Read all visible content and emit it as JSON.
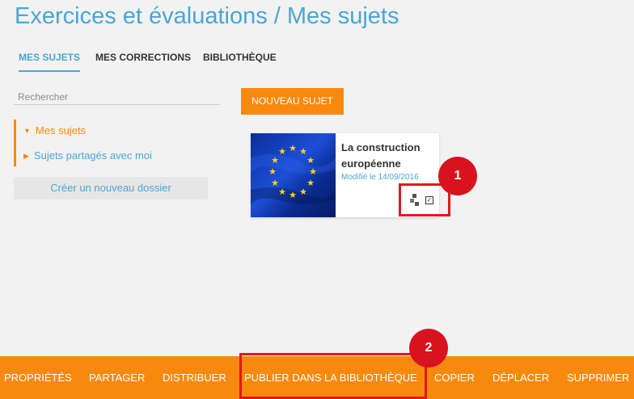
{
  "header": {
    "title": "Exercices et évaluations / Mes sujets"
  },
  "tabs": [
    {
      "label": "MES SUJETS",
      "active": true
    },
    {
      "label": "MES CORRECTIONS",
      "active": false
    },
    {
      "label": "BIBLIOTHÈQUE",
      "active": false
    }
  ],
  "sidebar": {
    "search_placeholder": "Rechercher",
    "folders": [
      {
        "label": "Mes sujets",
        "expanded": true
      },
      {
        "label": "Sujets partagés avec moi",
        "expanded": false
      }
    ],
    "new_folder_label": "Créer un nouveau dossier"
  },
  "main": {
    "new_subject_label": "NOUVEAU SUJET",
    "cards": [
      {
        "title": "La construction européenne",
        "date": "Modifié le 14/09/2016",
        "thumbnail_icon": "eu-flag-image",
        "icons": [
          "share-icon",
          "checkbox-icon"
        ],
        "selected": true
      }
    ]
  },
  "annotations": [
    {
      "number": "1"
    },
    {
      "number": "2"
    }
  ],
  "toolbar": {
    "items": [
      "PROPRIÉTÉS",
      "PARTAGER",
      "DISTRIBUER",
      "PUBLIER DANS LA BIBLIOTHÈQUE",
      "COPIER",
      "DÉPLACER",
      "SUPPRIMER"
    ]
  },
  "colors": {
    "accent_blue": "#4ba6d3",
    "accent_orange": "#f7890f",
    "annotation_red": "#d8121f",
    "background": "#f2f2f2"
  }
}
